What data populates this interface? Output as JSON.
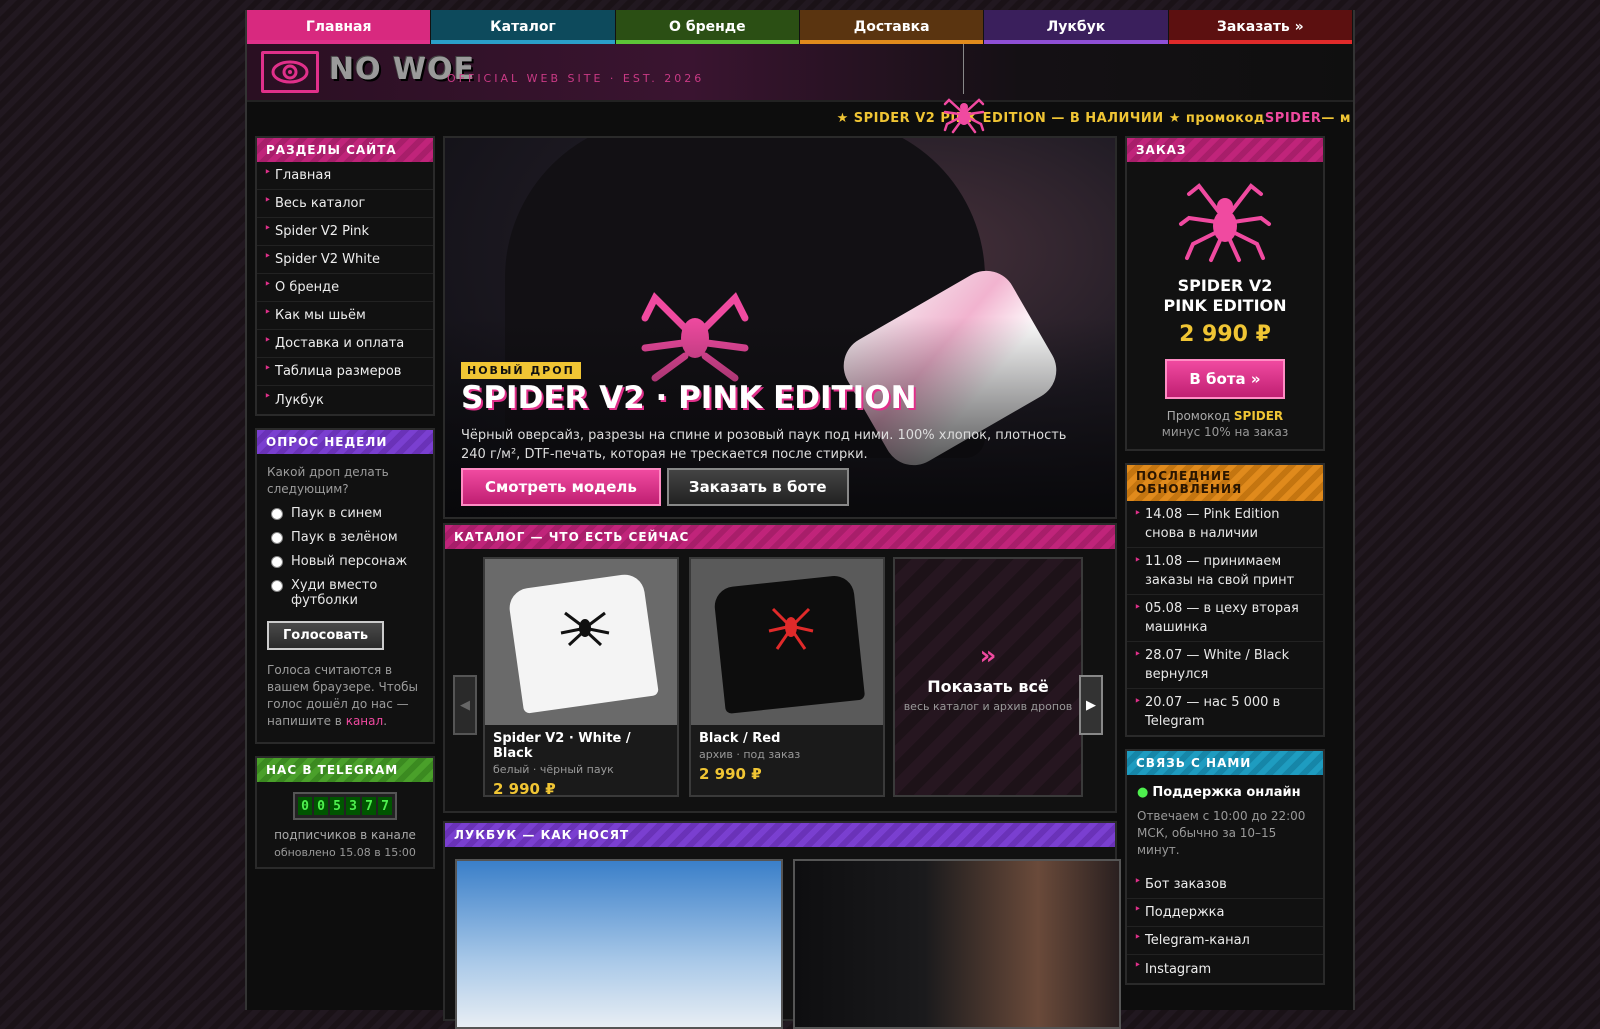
{
  "nav": [
    {
      "label": "Главная",
      "color": "#e0308a",
      "bg": "#d8297f"
    },
    {
      "label": "Каталог",
      "color": "#2a9fc9",
      "bg": "#0d4a5c"
    },
    {
      "label": "О бренде",
      "color": "#5cc437",
      "bg": "#2b4f14"
    },
    {
      "label": "Доставка",
      "color": "#e08a1c",
      "bg": "#5a3410"
    },
    {
      "label": "Лукбук",
      "color": "#8f4fd6",
      "bg": "#3a1f5c"
    },
    {
      "label": "Заказать »",
      "color": "#e02a2a",
      "bg": "#5c1010"
    }
  ],
  "header": {
    "brand": "NO WOE",
    "tagline": "OFFICIAL WEB SITE · EST. 2026"
  },
  "ticker": {
    "part1": "★ SPIDER V2 PINK EDITION — В НАЛИЧИИ ★ промокод ",
    "code": "SPIDER",
    "part2": " — м"
  },
  "sections": {
    "title": "РАЗДЕЛЫ САЙТА",
    "items": [
      "Главная",
      "Весь каталог",
      "Spider V2 Pink",
      "Spider V2 White",
      "О бренде",
      "Как мы шьём",
      "Доставка и оплата",
      "Таблица размеров",
      "Лукбук"
    ]
  },
  "poll": {
    "title": "ОПРОС НЕДЕЛИ",
    "question": "Какой дроп делать следующим?",
    "options": [
      "Паук в синем",
      "Паук в зелёном",
      "Новый персонаж",
      "Худи вместо футболки"
    ],
    "vote": "Голосовать",
    "note_before": "Голоса считаются в вашем браузере. Чтобы голос дошёл до нас — напишите в ",
    "note_link": "канал",
    "note_after": "."
  },
  "telegram": {
    "title": "НАС В TELEGRAM",
    "digits": [
      "0",
      "0",
      "5",
      "3",
      "7",
      "7"
    ],
    "subs": "подписчиков в канале",
    "updated": "обновлено 15.08 в 15:00"
  },
  "hero": {
    "badge": "НОВЫЙ ДРОП",
    "title": "SPIDER V2 · PINK EDITION",
    "desc": "Чёрный оверсайз, разрезы на спине и розовый паук под ними. 100% хлопок, плотность 240 г/м², DTF-печать, которая не трескается после стирки.",
    "btn_view": "Смотреть модель",
    "btn_order": "Заказать в боте"
  },
  "catalog": {
    "title": "КАТАЛОГ — ЧТО ЕСТЬ СЕЙЧАС",
    "cards": [
      {
        "name": "Spider V2 · White / Black",
        "sub": "белый · чёрный паук",
        "price": "2 990 ₽"
      },
      {
        "name": "Black / Red",
        "sub": "архив · под заказ",
        "price": "2 990 ₽"
      }
    ],
    "show_all": {
      "chev": "»",
      "title": "Показать всё",
      "sub": "весь каталог и архив дропов"
    }
  },
  "lookbook": {
    "title": "ЛУКБУК — КАК НОСЯТ"
  },
  "order": {
    "title": "ЗАКАЗ",
    "product_line1": "SPIDER V2",
    "product_line2": "PINK EDITION",
    "price": "2 990 ₽",
    "btn": "В бота »",
    "promo_label": "Промокод ",
    "promo_code": "SPIDER",
    "promo_sub": "минус 10% на заказ"
  },
  "updates": {
    "title": "ПОСЛЕДНИЕ ОБНОВЛЕНИЯ",
    "items": [
      "14.08 — Pink Edition снова в наличии",
      "11.08 — принимаем заказы на свой принт",
      "05.08 — в цеху вторая машинка",
      "28.07 — White / Black вернулся",
      "20.07 — нас 5 000 в Telegram"
    ]
  },
  "contact": {
    "title": "СВЯЗЬ С НАМИ",
    "online": "Поддержка онлайн",
    "note": "Отвечаем с 10:00 до 22:00 МСК, обычно за 10–15 минут.",
    "links": [
      "Бот заказов",
      "Поддержка",
      "Telegram-канал",
      "Instagram"
    ]
  },
  "colors": {
    "accent_pink": "#e0308a",
    "accent_yellow": "#f0c534",
    "online_green": "#4ef04e"
  }
}
